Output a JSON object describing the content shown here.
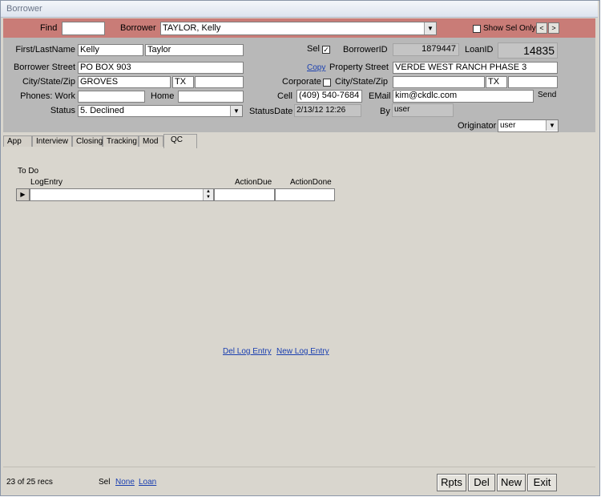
{
  "window": {
    "title": "Borrower"
  },
  "header": {
    "find_label": "Find",
    "find_value": "",
    "borrower_label": "Borrower",
    "borrower_value": "TAYLOR, Kelly",
    "show_sel_only_label": "Show Sel Only",
    "show_sel_only_checked": false,
    "prev_glyph": "<",
    "next_glyph": ">"
  },
  "form": {
    "first_last_label": "First/LastName",
    "first_name": "Kelly",
    "last_name": "Taylor",
    "borrower_street_label": "Borrower Street",
    "borrower_street": "PO BOX 903",
    "csz_label": "City/State/Zip",
    "city": "GROVES",
    "state": "TX",
    "zip": "",
    "phones_label": "Phones: Work",
    "work_phone": "",
    "home_label": "Home",
    "home_phone": "",
    "status_label": "Status",
    "status_value": "5. Declined",
    "sel_label": "Sel",
    "sel_checked": true,
    "borrower_id_label": "BorrowerID",
    "borrower_id": "1879447",
    "loan_id_label": "LoanID",
    "loan_id": "14835",
    "copy_link": "Copy",
    "property_street_label": "Property Street",
    "property_street": "VERDE WEST RANCH PHASE 3",
    "corporate_label": "Corporate",
    "corporate_checked": false,
    "prop_csz_label": "City/State/Zip",
    "prop_city": "",
    "prop_state": "TX",
    "prop_zip": "",
    "cell_label": "Cell",
    "cell_phone": "(409) 540-7684",
    "email_label": "EMail",
    "email": "kim@ckdlc.com",
    "send_label": "Send",
    "status_date_label": "StatusDate",
    "status_date": "2/13/12 12:26",
    "by_label": "By",
    "by_value": "user",
    "originator_label": "Originator",
    "originator_value": "user",
    "checkmark": "✓",
    "dropdown_glyph": "▼"
  },
  "tabs": [
    {
      "label": "App",
      "active": false
    },
    {
      "label": "Interview",
      "active": false
    },
    {
      "label": "Closing",
      "active": false
    },
    {
      "label": "Tracking",
      "active": false
    },
    {
      "label": "Mod",
      "active": false
    },
    {
      "label": "QC",
      "active": true
    }
  ],
  "qc": {
    "todo_label": "To Do",
    "columns": [
      "LogEntry",
      "ActionDue",
      "ActionDone"
    ],
    "row_selector_glyph": "▶",
    "del_log_entry": "Del Log Entry",
    "new_log_entry": "New Log Entry"
  },
  "footer": {
    "record_count": "23 of 25 recs",
    "sel_label": "Sel",
    "none_link": "None",
    "loan_link": "Loan",
    "rpts_button": "Rpts",
    "del_button": "Del",
    "new_button": "New",
    "exit_button": "Exit"
  },
  "colors": {
    "header_bg": "#c97c77",
    "form_bg": "#b8b8b8",
    "body_bg": "#d9d6ce",
    "link": "#1a3fb0"
  }
}
